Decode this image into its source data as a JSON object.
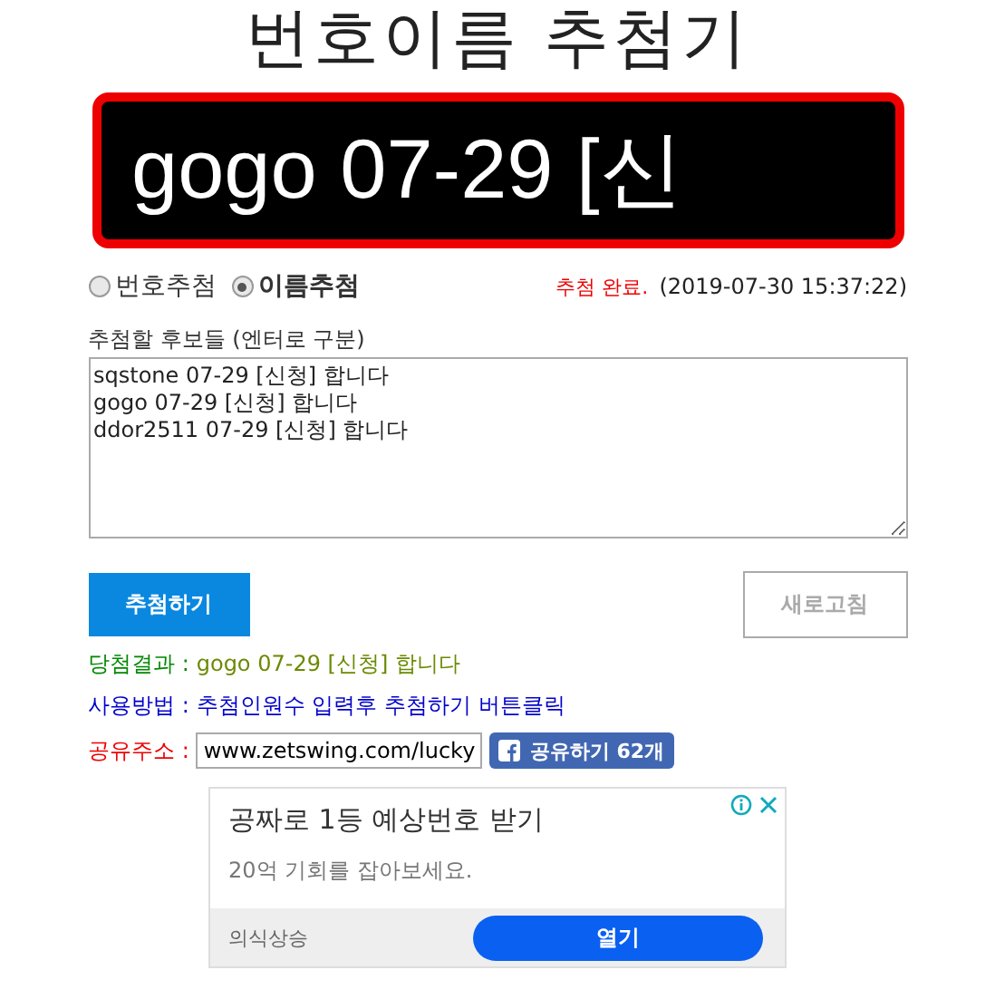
{
  "title": "번호이름 추첨기",
  "display": "gogo 07-29 [신",
  "modes": [
    {
      "label": "번호추첨",
      "selected": false
    },
    {
      "label": "이름추첨",
      "selected": true
    }
  ],
  "status": {
    "message": "추첨 완료.",
    "time": "(2019-07-30 15:37:22)"
  },
  "candidates": {
    "label": "추첨할 후보들 (엔터로 구분)",
    "value": "sqstone 07-29 [신청] 합니다\ngogo 07-29 [신청] 합니다\nddor2511 07-29 [신청] 합니다"
  },
  "buttons": {
    "draw": "추첨하기",
    "reset": "새로고침"
  },
  "result": {
    "label": "당첨결과 :",
    "value": "gogo 07-29 [신청] 합니다"
  },
  "usage": {
    "label": "사용방법 :",
    "value": "추첨인원수 입력후 추첨하기 버튼클릭"
  },
  "share": {
    "label": "공유주소 :",
    "url": "www.zetswing.com/lucky",
    "button": "공유하기 62개"
  },
  "ad": {
    "headline": "공짜로 1등 예상번호 받기",
    "description": "20억 기회를 잡아보세요.",
    "advertiser": "의식상승",
    "cta": "열기"
  }
}
